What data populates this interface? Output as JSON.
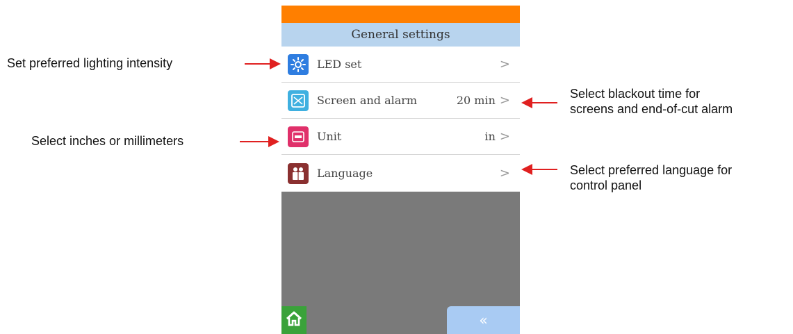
{
  "screen": {
    "title": "General settings",
    "rows": [
      {
        "label": "LED set",
        "value": "",
        "chevron": ">",
        "icon": "led-sun-icon",
        "icon_color": "#2e7de0"
      },
      {
        "label": "Screen and alarm",
        "value": "20 min",
        "chevron": ">",
        "icon": "screen-icon",
        "icon_color": "#3fb0e0"
      },
      {
        "label": "Unit",
        "value": "in",
        "chevron": ">",
        "icon": "unit-icon",
        "icon_color": "#e0306a"
      },
      {
        "label": "Language",
        "value": "",
        "chevron": ">",
        "icon": "people-icon",
        "icon_color": "#8a3030"
      }
    ],
    "home_icon": "home-icon",
    "back_label": "«"
  },
  "annotations": {
    "led": "Set preferred lighting intensity",
    "unit": "Select inches or millimeters",
    "screen_line1": "Select blackout time for",
    "screen_line2": "screens and end-of-cut alarm",
    "language_line1": "Select preferred language for",
    "language_line2": "control panel"
  },
  "colors": {
    "status_bar": "#ff7f00",
    "title_bar": "#b8d4ee",
    "background": "#7a7a7a",
    "arrow": "#e02020",
    "home": "#3aa23a",
    "back": "#a9cbf3"
  }
}
